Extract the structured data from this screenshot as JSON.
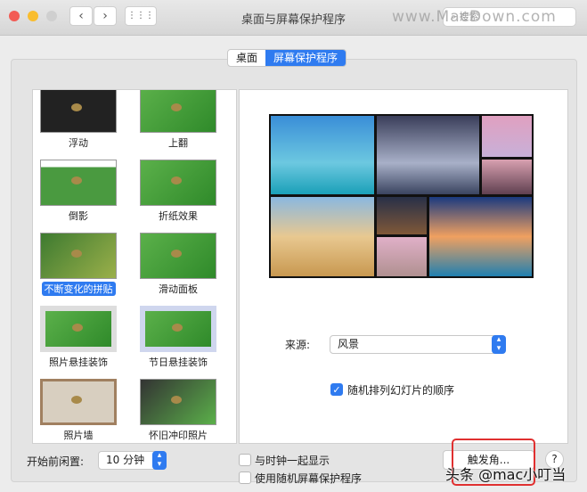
{
  "window": {
    "title": "桌面与屏幕保护程序",
    "search_placeholder": "搜索",
    "watermark_top": "www.MacDown.com"
  },
  "tabs": [
    {
      "label": "桌面",
      "selected": false
    },
    {
      "label": "屏幕保护程序",
      "selected": true
    }
  ],
  "savers": [
    {
      "label": "浮动",
      "selected": false
    },
    {
      "label": "上翻",
      "selected": false
    },
    {
      "label": "倒影",
      "selected": false
    },
    {
      "label": "折纸效果",
      "selected": false
    },
    {
      "label": "不断变化的拼贴",
      "selected": true
    },
    {
      "label": "滑动面板",
      "selected": false
    },
    {
      "label": "照片悬挂装饰",
      "selected": false
    },
    {
      "label": "节日悬挂装饰",
      "selected": false
    },
    {
      "label": "照片墙",
      "selected": false
    },
    {
      "label": "怀旧冲印照片",
      "selected": false
    }
  ],
  "options": {
    "source_label": "来源:",
    "source_value": "风景",
    "shuffle_label": "随机排列幻灯片的顺序",
    "shuffle_checked": true
  },
  "bottom": {
    "idle_label": "开始前闲置:",
    "idle_value": "10 分钟",
    "clock_label": "与时钟一起显示",
    "clock_checked": false,
    "random_label": "使用随机屏幕保护程序",
    "random_checked": false,
    "hot_corners": "触发角...",
    "help": "?"
  },
  "watermark_bottom": "头条 @mac小叮当"
}
